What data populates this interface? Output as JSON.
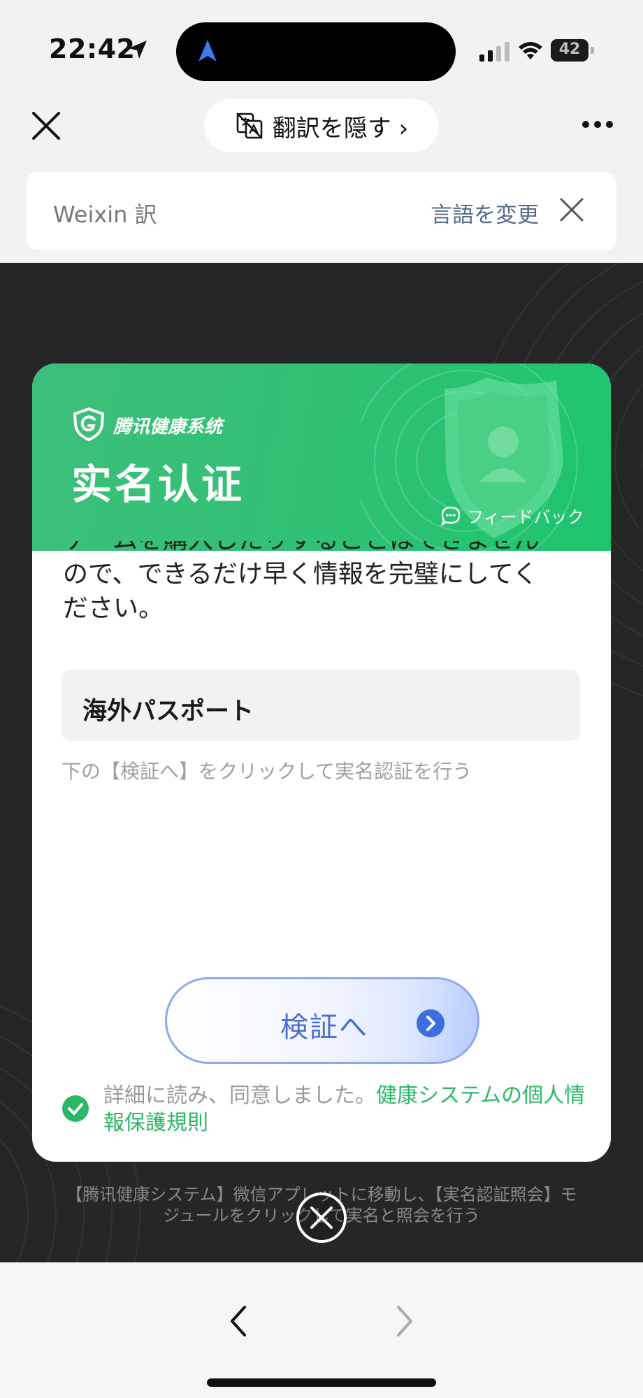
{
  "status_bar": {
    "time": "22:42",
    "battery": "42"
  },
  "nav": {
    "translate_toggle_label": "翻訳を隠す ›"
  },
  "translation_banner": {
    "brand": "Weixin 訳",
    "change_language": "言語を変更"
  },
  "card": {
    "brand": "腾讯健康系统",
    "title": "实名认证",
    "feedback": "フィードバック",
    "body_line_1": "ゲームを購入したりすることはできません",
    "body_line_2": "ので、できるだけ早く情報を完璧にしてく",
    "body_line_3": "ださい。",
    "document_type": "海外パスポート",
    "hint": "下の【検証へ】をクリックして実名認証を行う",
    "verify_button": "検証へ",
    "agree_text": "詳細に読み、同意しました。",
    "agree_link": "健康システムの個人情報保護規則"
  },
  "footer": {
    "note_line_1": "【腾讯健康システム】微信アプレットに移動し、【実名認証照会】モ",
    "note_line_2": "ジュールをクリックして実名と照会を行う"
  },
  "colors": {
    "accent_green": "#2bb866",
    "button_blue": "#4a6fd0",
    "dark_bg": "#262626"
  }
}
